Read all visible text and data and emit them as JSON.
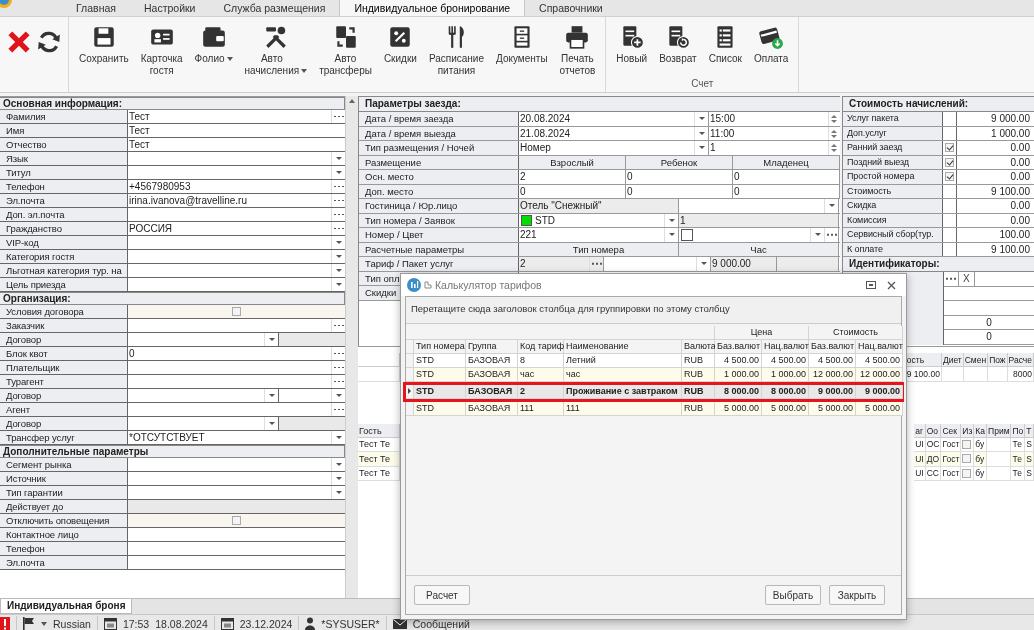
{
  "ribbon_tabs": [
    {
      "label": "Главная",
      "selected": false
    },
    {
      "label": "Настройки",
      "selected": false
    },
    {
      "label": "Служба размещения",
      "selected": false
    },
    {
      "label": "Индивидуальное бронирование",
      "selected": true
    },
    {
      "label": "Справочники",
      "selected": false
    }
  ],
  "toolbar": {
    "buttons": [
      {
        "label": "Сохранить",
        "dropdown": false
      },
      {
        "label": "Карточка гостя",
        "dropdown": false
      },
      {
        "label": "Фолио",
        "dropdown": true
      },
      {
        "label": "Авто начисления",
        "dropdown": true
      },
      {
        "label": "Авто трансферы",
        "dropdown": false
      },
      {
        "label": "Скидки",
        "dropdown": false
      },
      {
        "label": "Расписание питания",
        "dropdown": false
      },
      {
        "label": "Документы",
        "dropdown": false
      },
      {
        "label": "Печать отчетов",
        "dropdown": false
      }
    ],
    "account_group": {
      "title": "Счет",
      "buttons": [
        {
          "label": "Новый"
        },
        {
          "label": "Возврат"
        },
        {
          "label": "Список"
        },
        {
          "label": "Оплата"
        }
      ]
    }
  },
  "guest_form": {
    "sections": [
      {
        "title": "Основная информация:",
        "rows": [
          {
            "label": "Фамилия",
            "value": "Тест",
            "kind": "dots"
          },
          {
            "label": "Имя",
            "value": "Тест",
            "kind": "text"
          },
          {
            "label": "Отчество",
            "value": "Тест",
            "kind": "text"
          },
          {
            "label": "Язык",
            "kind": "dropdown"
          },
          {
            "label": "Титул",
            "kind": "dropdown"
          },
          {
            "label": "Телефон",
            "value": "+4567980953",
            "kind": "dots"
          },
          {
            "label": "Эл.почта",
            "value": "irina.ivanova@travelline.ru",
            "kind": "dots"
          },
          {
            "label": "Доп. эл.почта",
            "kind": "dots"
          },
          {
            "label": "Гражданство",
            "value": "РОССИЯ",
            "kind": "dots"
          },
          {
            "label": "VIP-код",
            "kind": "dropdown"
          },
          {
            "label": "Категория гостя",
            "kind": "dropdown"
          },
          {
            "label": "Льготная категория тур. на",
            "kind": "dropdown"
          },
          {
            "label": "Цель приезда",
            "kind": "dropdown"
          }
        ]
      },
      {
        "title": "Организация:",
        "rows": [
          {
            "label": "Условия договора",
            "kind": "checkbox",
            "checked": false
          },
          {
            "label": "Заказчик",
            "kind": "dots"
          },
          {
            "label": "Договор",
            "kind": "split-grey"
          },
          {
            "label": "Блок квот",
            "value": "0",
            "kind": "dots"
          },
          {
            "label": "Плательщик",
            "kind": "dots"
          },
          {
            "label": "Турагент",
            "kind": "dots"
          },
          {
            "label": "Договор",
            "kind": "split-dropdown"
          },
          {
            "label": "Агент",
            "kind": "dots"
          },
          {
            "label": "Договор",
            "kind": "split-grey"
          },
          {
            "label": "Трансфер услуг",
            "value": "*ОТСУТСТВУЕТ",
            "kind": "dropdown"
          }
        ]
      },
      {
        "title": "Дополнительные параметры",
        "rows": [
          {
            "label": "Сегмент рынка",
            "kind": "dropdown"
          },
          {
            "label": "Источник",
            "kind": "dropdown"
          },
          {
            "label": "Тип гарантии",
            "kind": "dropdown"
          },
          {
            "label": "Действует до",
            "kind": "disabled"
          },
          {
            "label": "Отключить оповещения",
            "kind": "checkbox",
            "checked": false
          },
          {
            "label": "Контактное лицо",
            "kind": "text"
          },
          {
            "label": "Телефон",
            "kind": "text"
          },
          {
            "label": "Эл.почта",
            "kind": "text"
          }
        ]
      }
    ]
  },
  "stay": {
    "title": "Параметры заезда:",
    "dates": [
      {
        "label": "Дата / время заезда",
        "value": "20.08.2024",
        "second": "15:00"
      },
      {
        "label": "Дата / время выезда",
        "value": "21.08.2024",
        "second": "11:00"
      },
      {
        "label": "Тип размещения / Ночей",
        "value": "Номер",
        "second": "1"
      }
    ],
    "occupancy": {
      "label": "Размещение",
      "columns": [
        "Взрослый",
        "Ребенок",
        "Младенец"
      ],
      "rows": [
        {
          "label": "Осн. место",
          "values": [
            "2",
            "0",
            "0"
          ]
        },
        {
          "label": "Доп. место",
          "values": [
            "0",
            "0",
            "0"
          ]
        }
      ]
    },
    "hotel": {
      "label": "Гостиница / Юр.лицо",
      "value": "Отель \"Снежный\""
    },
    "room_type": {
      "label": "Тип номера / Заявок",
      "value": "STD",
      "color": "#00e000",
      "second": "1"
    },
    "room": {
      "label": "Номер / Цвет",
      "value": "221",
      "color": "#ffffff"
    },
    "calc": {
      "label": "Расчетные параметры",
      "columns": [
        "Тип номера",
        "Час"
      ]
    },
    "tariff": {
      "label": "Тариф / Пакет услуг",
      "value": "2",
      "amount": "9 000.00"
    },
    "payment_type": {
      "label": "Тип опл"
    },
    "discounts": {
      "label": "Скидки"
    }
  },
  "charges": {
    "title": "Стоимость начислений:",
    "rows": [
      {
        "label": "Услуг пакета",
        "amount": "9 000.00",
        "kind": "plain"
      },
      {
        "label": "Доп.услуг",
        "amount": "1 000.00",
        "kind": "plain"
      },
      {
        "label": "Ранний заезд",
        "amount": "0.00",
        "kind": "checkbox",
        "checked": true
      },
      {
        "label": "Поздний выезд",
        "amount": "0.00",
        "kind": "checkbox",
        "checked": true
      },
      {
        "label": "Простой номера",
        "amount": "0.00",
        "kind": "checkbox",
        "checked": true
      },
      {
        "label": "Стоимость",
        "amount": "9 100.00",
        "kind": "plain"
      },
      {
        "label": "Скидка",
        "amount": "0.00",
        "kind": "plain"
      },
      {
        "label": "Комиссия",
        "amount": "0.00",
        "kind": "plain"
      },
      {
        "label": "Сервисный сбор(тур.",
        "amount": "100.00",
        "kind": "plain"
      },
      {
        "label": "К оплате",
        "amount": "9 100.00",
        "kind": "plain"
      }
    ]
  },
  "identifiers": {
    "title": "Идентификаторы:",
    "clear_button": "X",
    "rows": [
      "0",
      "0"
    ]
  },
  "services_grid": {
    "columns": [
      {
        "header": "ость",
        "value": "9 100.00"
      },
      {
        "header": "Диет"
      },
      {
        "header": "Смен"
      },
      {
        "header": "Пож"
      },
      {
        "header": "Расче",
        "value": "8000"
      }
    ]
  },
  "guests_grid": {
    "left_header": "Гость",
    "left_rows": [
      "Тест Те",
      "Тест Те",
      "Тест Те"
    ],
    "columns": [
      "аг",
      "Оо",
      "Сек",
      "Из",
      "Ка",
      "Прим",
      "По",
      "Т"
    ],
    "rows": [
      {
        "cells": [
          "UI",
          "ОС",
          "Гост",
          {
            "checked": false
          },
          "бу",
          null,
          "Те",
          "S"
        ]
      },
      {
        "cells": [
          "UI",
          "ДО",
          "Гост",
          {
            "checked": false
          },
          "бу",
          null,
          "Те",
          "S"
        ]
      },
      {
        "cells": [
          "UI",
          "СС",
          "Гост",
          {
            "checked": false
          },
          "бу",
          null,
          "Те",
          "S"
        ]
      }
    ]
  },
  "tariff_calculator": {
    "title": "Калькулятор тарифов",
    "group_hint": "Перетащите сюда заголовок столбца для группировки по этому столбцу",
    "bands": [
      "Цена",
      "Стоимость"
    ],
    "columns": [
      "Тип номера",
      "Группа",
      "Код тариф",
      "Наименование",
      "Валюта",
      "Баз.валют",
      "Нац.валют",
      "Баз.валют",
      "Нац.валют"
    ],
    "rows": [
      {
        "cells": [
          "STD",
          "БАЗОВАЯ",
          "8",
          "Летний",
          "RUB",
          "4 500.00",
          "4 500.00",
          "4 500.00",
          "4 500.00"
        ],
        "selected": false
      },
      {
        "cells": [
          "STD",
          "БАЗОВАЯ",
          "час",
          "час",
          "RUB",
          "1 000.00",
          "1 000.00",
          "12 000.00",
          "12 000.00"
        ],
        "selected": false
      },
      {
        "cells": [
          "STD",
          "БАЗОВАЯ",
          "2",
          "Проживание с завтраком",
          "RUB",
          "8 000.00",
          "8 000.00",
          "9 000.00",
          "9 000.00"
        ],
        "selected": true
      },
      {
        "cells": [
          "STD",
          "БАЗОВАЯ",
          "111",
          "111",
          "RUB",
          "5 000.00",
          "5 000.00",
          "5 000.00",
          "5 000.00"
        ],
        "selected": false
      }
    ],
    "buttons_left": [
      "Расчет"
    ],
    "buttons_right": [
      "Выбрать",
      "Закрыть"
    ]
  },
  "doc_tab": {
    "label": "Индивидуальная броня",
    "selected": true
  },
  "status_bar": {
    "language": "Russian",
    "time": "17:53",
    "date": "18.08.2024",
    "end_date": "23.12.2024",
    "user": "*SYSUSER*",
    "messages": "Сообщений"
  }
}
